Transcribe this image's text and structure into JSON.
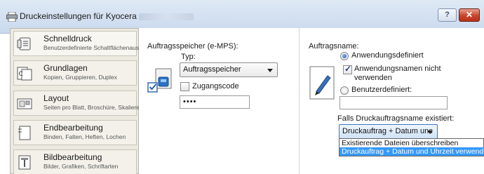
{
  "window": {
    "title": "Druckeinstellungen für Kyocera",
    "help_label": "?",
    "close_label": "✕"
  },
  "sidebar": {
    "items": [
      {
        "label": "Schnelldruck",
        "sub": "Benutzerdefinierte Schaltflächenauswahl",
        "icon": "quick-print-icon"
      },
      {
        "label": "Grundlagen",
        "sub": "Kopien, Gruppieren, Duplex",
        "icon": "basics-icon"
      },
      {
        "label": "Layout",
        "sub": "Seiten pro Blatt, Broschüre, Skalieren",
        "icon": "layout-icon"
      },
      {
        "label": "Endbearbeitung",
        "sub": "Binden, Falten, Heften, Lochen",
        "icon": "finishing-icon"
      },
      {
        "label": "Bildbearbeitung",
        "sub": "Bilder, Grafiken, Schriftarten",
        "icon": "imaging-icon"
      }
    ]
  },
  "job_storage": {
    "heading": "Auftragsspeicher (e-MPS):",
    "type_label": "Typ:",
    "type_value": "Auftragsspeicher",
    "access_code_label": "Zugangscode",
    "access_code_value": "••••"
  },
  "job_name": {
    "heading": "Auftragsname:",
    "option_app_defined": "Anwendungsdefiniert",
    "checkbox_no_app_name_line1": "Anwendungsnamen nicht",
    "checkbox_no_app_name_line2": "verwenden",
    "option_user_defined": "Benutzerdefiniert:",
    "user_defined_value": "",
    "if_exists_label": "Falls Druckauftragsname existiert:",
    "if_exists_value": "Druckauftrag + Datum unc",
    "dropdown_options": [
      "Existierende Dateien überschreiben",
      "Druckauftrag + Datum und Uhrzeit verwenden"
    ]
  },
  "colors": {
    "accent": "#3399ff",
    "titlebar": "#c9d9ee",
    "sidebar_bg": "#ece9e0"
  }
}
